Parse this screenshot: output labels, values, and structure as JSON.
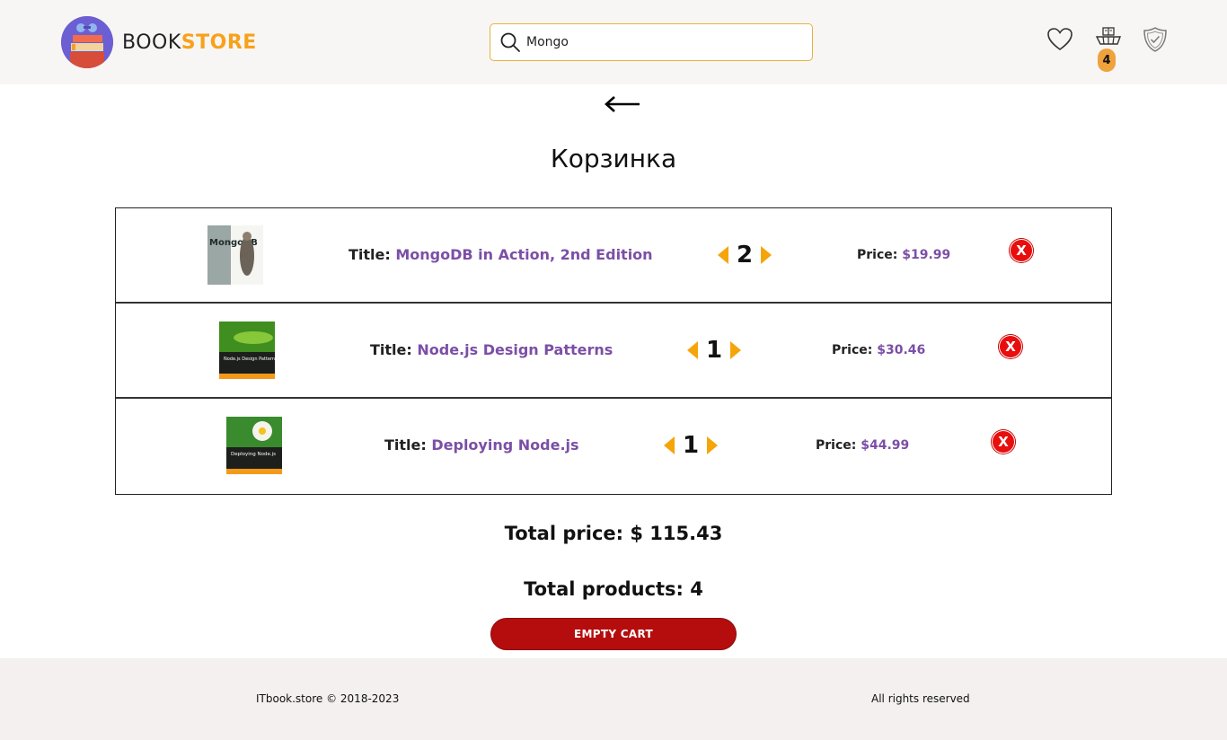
{
  "header": {
    "logo": {
      "part1": "BOOK",
      "part2": "STORE"
    },
    "search": {
      "value": "Mongo"
    },
    "icons": [
      "heart-icon",
      "cart-icon",
      "shield-icon"
    ],
    "cart_count": "4"
  },
  "page": {
    "title": "Корзинка"
  },
  "cart": {
    "title_label": "Title:",
    "price_label": "Price:",
    "items": [
      {
        "title": "MongoDB in Action, 2nd Edition",
        "qty": "2",
        "price": "$19.99",
        "remove": "X"
      },
      {
        "title": "Node.js Design Patterns",
        "qty": "1",
        "price": "$30.46",
        "remove": "X"
      },
      {
        "title": "Deploying Node.js",
        "qty": "1",
        "price": "$44.99",
        "remove": "X"
      }
    ]
  },
  "summary": {
    "total_price": "Total price: $ 115.43",
    "total_products": "Total products: 4",
    "empty_button": "EMPTY CART"
  },
  "footer": {
    "left": "ITbook.store © 2018-2023",
    "right": "All rights reserved"
  },
  "colors": {
    "accent": "#f7a21b",
    "link": "#7b4fa6",
    "danger": "#b50d0d"
  }
}
